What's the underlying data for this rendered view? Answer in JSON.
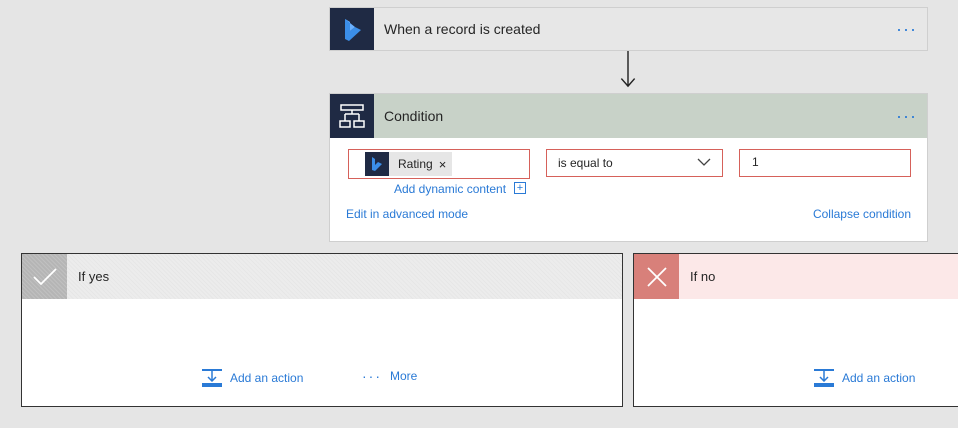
{
  "trigger": {
    "title": "When a record is created",
    "menu": "···",
    "icon": "dynamics-logo-icon"
  },
  "condition": {
    "title": "Condition",
    "menu": "···",
    "icon": "condition-icon",
    "operand": {
      "token_label": "Rating",
      "remove": "×"
    },
    "operator": {
      "selected": "is equal to"
    },
    "value": "1",
    "add_dynamic_content": "Add dynamic content",
    "add_dynamic_plus": "+",
    "edit_advanced": "Edit in advanced mode",
    "collapse": "Collapse condition"
  },
  "if_yes": {
    "title": "If yes",
    "add_action": "Add an action",
    "more_dots": "···",
    "more": "More"
  },
  "if_no": {
    "title": "If no",
    "add_action": "Add an action"
  },
  "colors": {
    "accent": "#2a7ad6",
    "error_border": "#d6615a",
    "logo_bg": "#1f2a44",
    "no_header": "#fce8e8"
  }
}
